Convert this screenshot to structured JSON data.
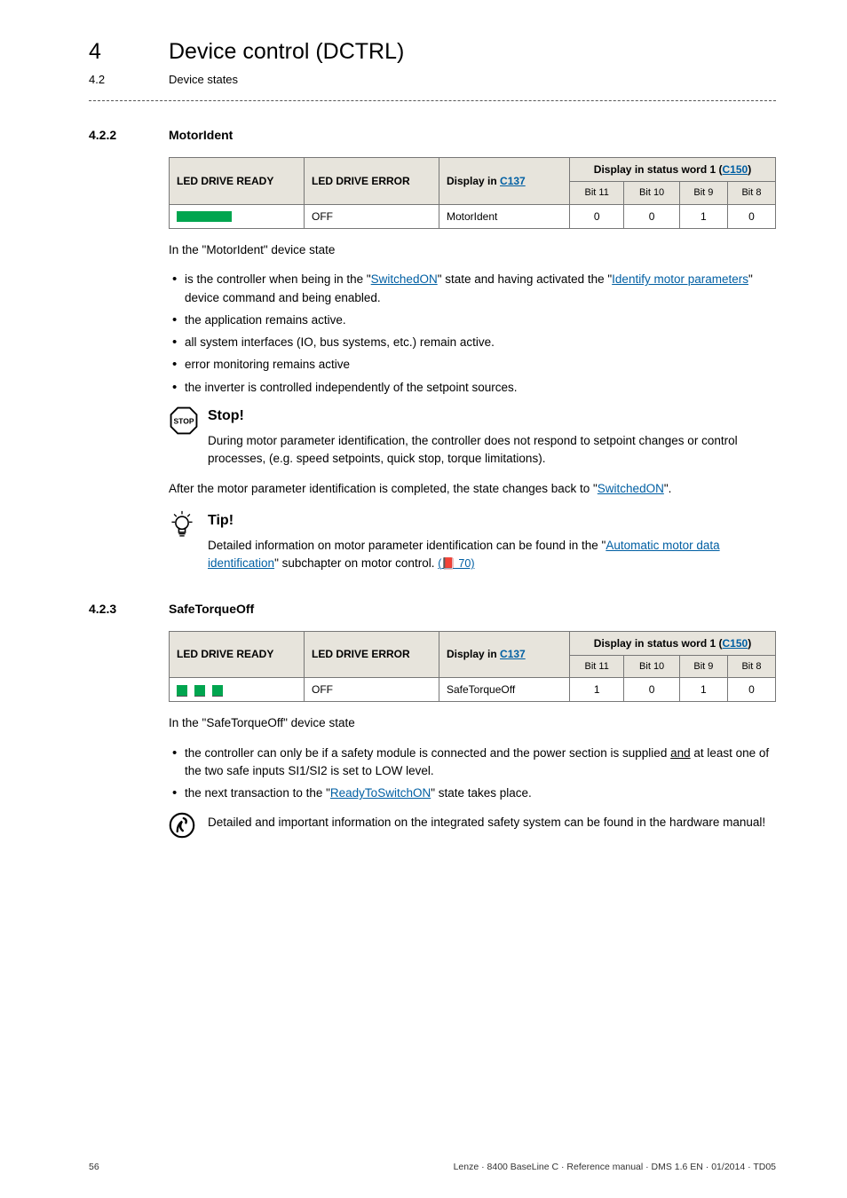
{
  "header": {
    "chapter_num": "4",
    "chapter_title": "Device control (DCTRL)",
    "section_num": "4.2",
    "section_title": "Device states"
  },
  "sec422": {
    "num": "4.2.2",
    "title": "MotorIdent",
    "table": {
      "h1": "LED DRIVE READY",
      "h2": "LED DRIVE ERROR",
      "h3": "Display in ",
      "h3_link": "C137",
      "h4": "Display in status word 1 (",
      "h4_link": "C150",
      "h4_close": ")",
      "sub": [
        "Bit 11",
        "Bit 10",
        "Bit 9",
        "Bit 8"
      ],
      "row": {
        "led_error": "OFF",
        "display": "MotorIdent",
        "bits": [
          "0",
          "0",
          "1",
          "0"
        ]
      }
    },
    "intro": "In the \"MotorIdent\" device state",
    "bullets": {
      "b1_a": "is the controller when being in the \"",
      "b1_link1": "SwitchedON",
      "b1_b": "\" state and having activated the \"",
      "b1_link2": "Identify motor parameters",
      "b1_c": "\" device command and being enabled.",
      "b2": "the application remains active.",
      "b3": "all system interfaces (IO, bus systems, etc.) remain active.",
      "b4": "error monitoring remains active",
      "b5": "the inverter is controlled independently of the setpoint sources."
    },
    "stop": {
      "title": "Stop!",
      "body": "During motor parameter identification, the controller does not respond to setpoint changes or control processes, (e.g. speed setpoints, quick stop, torque limitations)."
    },
    "after_a": "After the motor parameter identification is completed, the state changes back to \"",
    "after_link": "SwitchedON",
    "after_b": "\".",
    "tip": {
      "title": "Tip!",
      "body_a": "Detailed information on motor parameter identification can be found in the \"",
      "link": "Automatic motor data identification",
      "body_b": "\" subchapter on motor control. ",
      "ref": "( 70)"
    }
  },
  "sec423": {
    "num": "4.2.3",
    "title": "SafeTorqueOff",
    "table": {
      "h1": "LED DRIVE READY",
      "h2": "LED DRIVE ERROR",
      "h3": "Display in ",
      "h3_link": "C137",
      "h4": "Display in status word 1 (",
      "h4_link": "C150",
      "h4_close": ")",
      "sub": [
        "Bit 11",
        "Bit 10",
        "Bit 9",
        "Bit 8"
      ],
      "row": {
        "led_error": "OFF",
        "display": "SafeTorqueOff",
        "bits": [
          "1",
          "0",
          "1",
          "0"
        ]
      }
    },
    "intro": "In the \"SafeTorqueOff\" device state",
    "bullets": {
      "b1_a": "the controller can only be if a safety module is connected and the power section is supplied ",
      "b1_u": "and",
      "b1_b": " at least one of the two safe inputs SI1/SI2 is set to LOW level.",
      "b2_a": "the next transaction to the \"",
      "b2_link": "ReadyToSwitchON",
      "b2_b": "\" state takes place."
    },
    "info": "Detailed and important information on the integrated safety system can be found in the hardware manual!"
  },
  "footer": {
    "page": "56",
    "meta": "Lenze · 8400 BaseLine C · Reference manual · DMS 1.6 EN · 01/2014 · TD05"
  }
}
